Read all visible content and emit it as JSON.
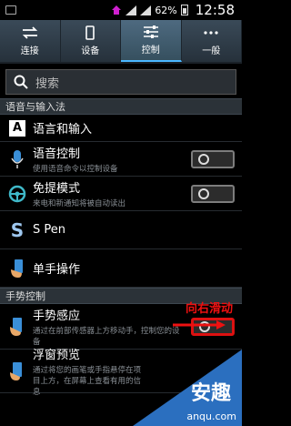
{
  "status": {
    "battery": "62%",
    "time": "12:58"
  },
  "tabs": [
    {
      "label": "连接",
      "icon": "arrows-icon"
    },
    {
      "label": "设备",
      "icon": "phone-icon"
    },
    {
      "label": "控制",
      "icon": "sliders-icon"
    },
    {
      "label": "一般",
      "icon": "more-icon"
    }
  ],
  "search": {
    "placeholder": "搜索"
  },
  "section1": "语音与输入法",
  "items1": [
    {
      "title": "语言和输入"
    },
    {
      "title": "语音控制",
      "desc": "使用语音命令以控制设备"
    },
    {
      "title": "免提模式",
      "desc": "来电和新通知将被自动读出"
    },
    {
      "title": "S Pen"
    },
    {
      "title": "单手操作"
    }
  ],
  "section2": "手势控制",
  "items2": [
    {
      "title": "手势感应",
      "desc": "通过在前部传感器上方移动手，控制您的设备"
    },
    {
      "title": "浮窗预览",
      "desc": "通过将您的画笔或手指悬停在项目上方，在屏幕上查看有用的信息"
    }
  ],
  "annotation": "向右滑动",
  "watermark": {
    "text": "安趣",
    "url": "anqu.com"
  }
}
